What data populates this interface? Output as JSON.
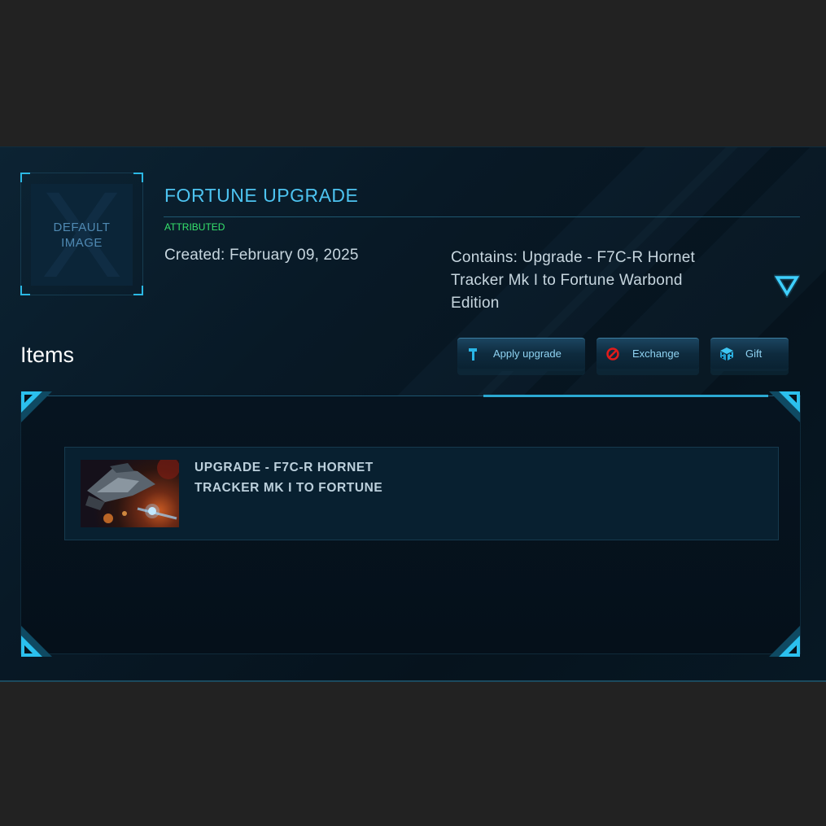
{
  "pledge": {
    "thumbnail_text": "DEFAULT IMAGE",
    "title": "FORTUNE UPGRADE",
    "status": "ATTRIBUTED",
    "created": "Created: February 09, 2025",
    "contains": "Contains: Upgrade - F7C-R Hornet Tracker Mk I to Fortune Warbond Edition",
    "toggle_icon": "chevron-down-triangle-icon"
  },
  "items_section": {
    "heading": "Items",
    "buttons": [
      {
        "label": "Apply upgrade",
        "icon": "wrench-icon"
      },
      {
        "label": "Exchange",
        "icon": "no-entry-icon"
      },
      {
        "label": "Gift",
        "icon": "gift-box-icon"
      }
    ],
    "items": [
      {
        "name": "UPGRADE - F7C-R HORNET TRACKER MK I TO FORTUNE"
      }
    ]
  },
  "colors": {
    "accent": "#2bb8e4",
    "title": "#4dc3f0",
    "status": "#36e36c",
    "background": "#222222",
    "panel": "#081926"
  }
}
